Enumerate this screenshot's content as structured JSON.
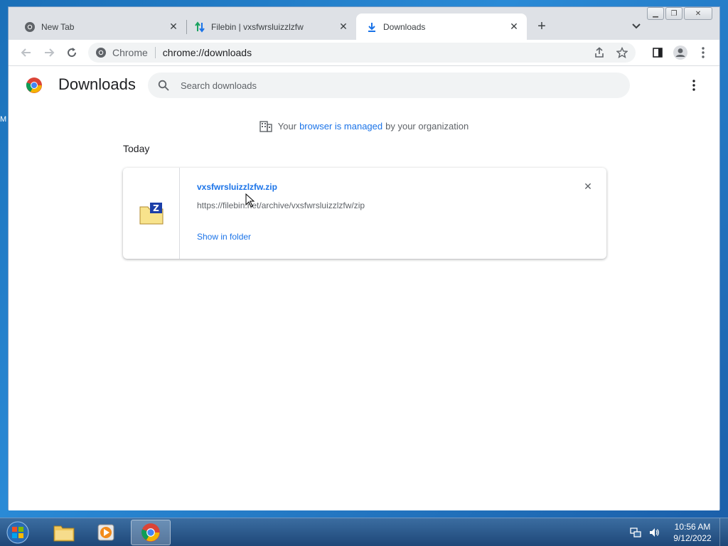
{
  "desktop": {
    "edge_label": "M"
  },
  "window": {
    "controls": {
      "minimize_icon": "minimize-icon",
      "restore_icon": "restore-icon",
      "close_icon": "close-icon"
    }
  },
  "tabs": [
    {
      "title": "New Tab",
      "icon": "chrome-icon",
      "active": false
    },
    {
      "title": "Filebin | vxsfwrsluizzlzfw",
      "icon": "filebin-arrows-icon",
      "active": false
    },
    {
      "title": "Downloads",
      "icon": "download-icon",
      "active": true
    }
  ],
  "toolbar": {
    "omnibox": {
      "scheme_label": "Chrome",
      "url": "chrome://downloads"
    }
  },
  "downloads_page": {
    "title": "Downloads",
    "search": {
      "placeholder": "Search downloads"
    },
    "managed_notice": {
      "prefix": "Your",
      "link": "browser is managed",
      "suffix": "by your organization"
    },
    "section_label": "Today",
    "items": [
      {
        "file_name": "vxsfwrsluizzlzfw.zip",
        "url": "https://filebin.net/archive/vxsfwrsluizzlzfw/zip",
        "action": "Show in folder",
        "icon": "zip-file-icon"
      }
    ]
  },
  "taskbar": {
    "apps": [
      {
        "name": "windows-explorer",
        "icon": "folder-icon"
      },
      {
        "name": "media-player",
        "icon": "media-player-icon"
      },
      {
        "name": "chrome",
        "icon": "chrome-icon",
        "active": true
      }
    ],
    "clock": {
      "time": "10:56 AM",
      "date": "9/12/2022"
    }
  },
  "colors": {
    "accent": "#1a73e8",
    "tabstrip": "#dee1e6",
    "omnibox": "#f1f3f4",
    "taskbar": "#2a5788"
  }
}
